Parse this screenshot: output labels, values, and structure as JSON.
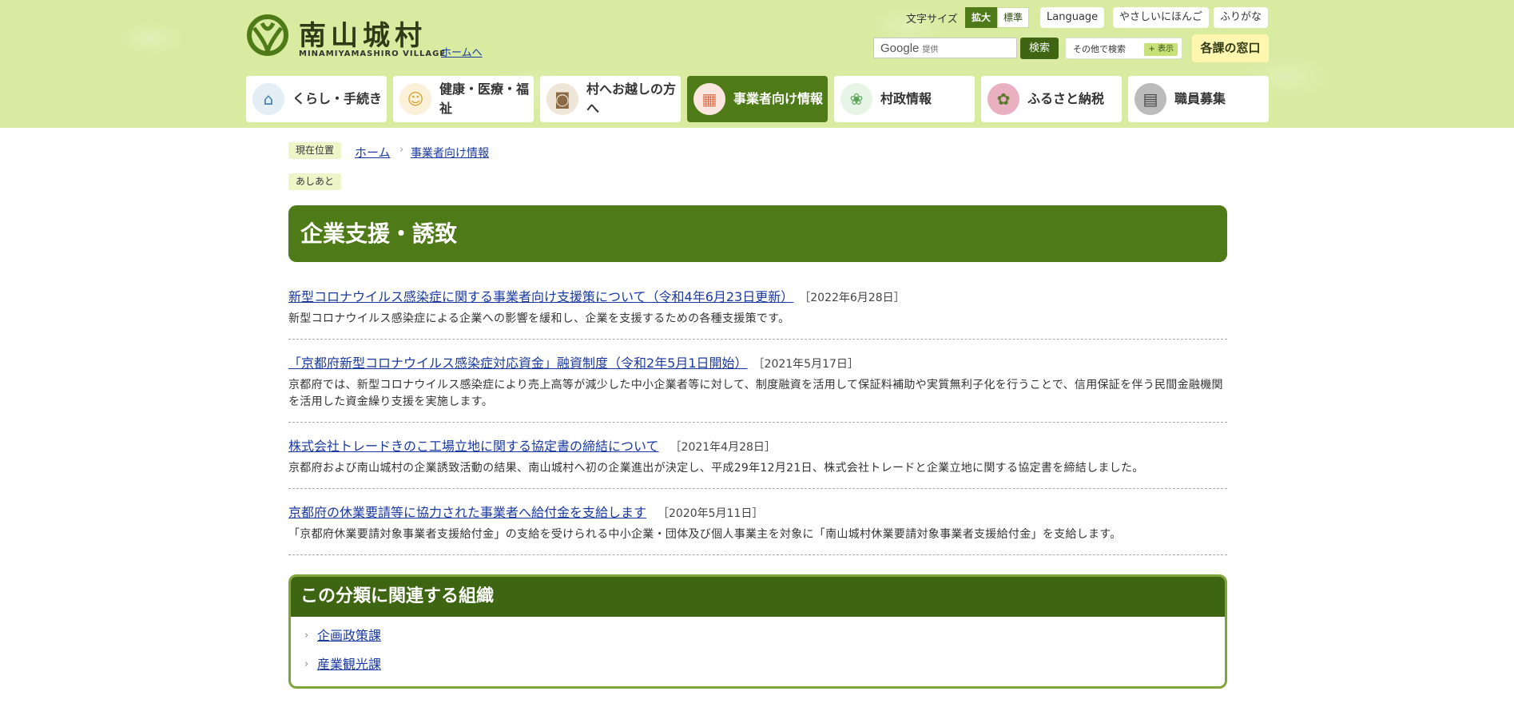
{
  "header": {
    "logo_title": "南山城村",
    "logo_sub": "MINAMIYAMASHIRO VILLAGE",
    "home_link": "ホームへ",
    "font_size_label": "文字サイズ",
    "font_size_options": [
      "拡大",
      "標準"
    ],
    "language": "Language",
    "easy_japanese": "やさしいにほんご",
    "furigana": "ふりがな",
    "search_google": "Google",
    "search_provided": "提供",
    "search_button": "検索",
    "other_search": "その他で検索",
    "show_button": "+ 表示",
    "window_button": "各課の窓口"
  },
  "nav": [
    {
      "label": "くらし・手続き",
      "icon": "house-icon"
    },
    {
      "label": "健康・医療・福祉",
      "icon": "person-icon"
    },
    {
      "label": "村へお越しの方へ",
      "icon": "camera-icon"
    },
    {
      "label": "事業者向け情報",
      "icon": "building-icon"
    },
    {
      "label": "村政情報",
      "icon": "village-emblem-icon"
    },
    {
      "label": "ふるさと納税",
      "icon": "furusato-photo-icon"
    },
    {
      "label": "職員募集",
      "icon": "office-photo-icon"
    }
  ],
  "breadcrumb": {
    "label": "現在位置",
    "home": "ホーム",
    "current": "事業者向け情報",
    "ashiato": "あしあと"
  },
  "page_title": "企業支援・誘致",
  "entries": [
    {
      "title": "新型コロナウイルス感染症に関する事業者向け支援策について（令和4年6月23日更新）",
      "date": "［2022年6月28日］",
      "desc": "新型コロナウイルス感染症による企業への影響を緩和し、企業を支援するための各種支援策です。"
    },
    {
      "title": "「京都府新型コロナウイルス感染症対応資金」融資制度（令和2年5月1日開始）",
      "date": "［2021年5月17日］",
      "desc": "京都府では、新型コロナウイルス感染症により売上高等が減少した中小企業者等に対して、制度融資を活用して保証料補助や実質無利子化を行うことで、信用保証を伴う民間金融機関を活用した資金繰り支援を実施します。"
    },
    {
      "title": "株式会社トレードきのこ工場立地に関する協定書の締結について",
      "date": "［2021年4月28日］",
      "desc": "京都府および南山城村の企業誘致活動の結果、南山城村へ初の企業進出が決定し、平成29年12月21日、株式会社トレードと企業立地に関する協定書を締結しました。"
    },
    {
      "title": "京都府の休業要請等に協力された事業者へ給付金を支給します",
      "date": "［2020年5月11日］",
      "desc": "「京都府休業要請対象事業者支援給付金」の支給を受けられる中小企業・団体及び個人事業主を対象に「南山城村休業要請対象事業者支援給付金」を支給します。"
    }
  ],
  "related": {
    "heading": "この分類に関連する組織",
    "items": [
      "企画政策課",
      "産業観光課"
    ]
  },
  "colors": {
    "brand_green": "#4e7a18",
    "header_bg": "#d8eba0",
    "link_blue": "#1a3aa0"
  }
}
